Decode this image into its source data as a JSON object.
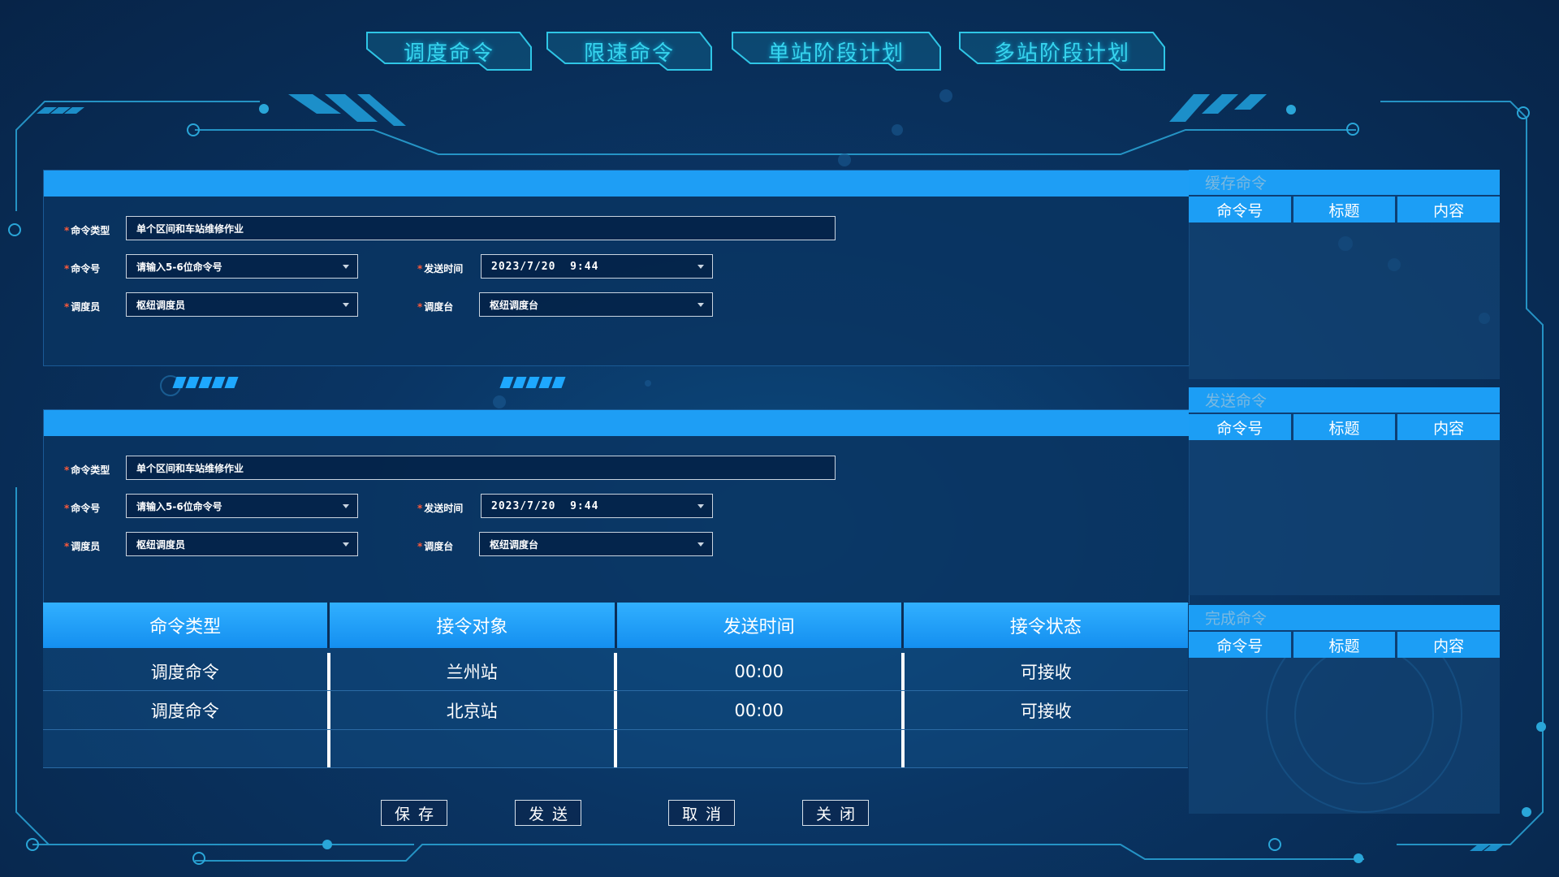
{
  "tabs": [
    {
      "label": "调度命令"
    },
    {
      "label": "限速命令"
    },
    {
      "label": "单站阶段计划"
    },
    {
      "label": "多站阶段计划"
    }
  ],
  "form1": {
    "type_label": "命令类型",
    "type_value": "单个区间和车站维修作业",
    "no_label": "命令号",
    "no_value": "请输入5-6位命令号",
    "time_label": "发送时间",
    "time_value": "2023/7/20  9:44",
    "dispatcher_label": "调度员",
    "dispatcher_value": "枢纽调度员",
    "desk_label": "调度台",
    "desk_value": "枢纽调度台"
  },
  "form2": {
    "type_label": "命令类型",
    "type_value": "单个区间和车站维修作业",
    "no_label": "命令号",
    "no_value": "请输入5-6位命令号",
    "time_label": "发送时间",
    "time_value": "2023/7/20  9:44",
    "dispatcher_label": "调度员",
    "dispatcher_value": "枢纽调度员",
    "desk_label": "调度台",
    "desk_value": "枢纽调度台"
  },
  "table": {
    "headers": [
      "命令类型",
      "接令对象",
      "发送时间",
      "接令状态"
    ],
    "rows": [
      [
        "调度命令",
        "兰州站",
        "00:00",
        "可接收"
      ],
      [
        "调度命令",
        "北京站",
        "00:00",
        "可接收"
      ],
      [
        "",
        "",
        "",
        ""
      ]
    ]
  },
  "side": {
    "cache": {
      "title": "缓存命令",
      "cols": [
        "命令号",
        "标题",
        "内容"
      ]
    },
    "sent": {
      "title": "发送命令",
      "cols": [
        "命令号",
        "标题",
        "内容"
      ]
    },
    "done": {
      "title": "完成命令",
      "cols": [
        "命令号",
        "标题",
        "内容"
      ]
    }
  },
  "buttons": {
    "save": "保存",
    "send": "发送",
    "cancel": "取消",
    "close": "关闭"
  },
  "colors": {
    "accent": "#1e9ef5",
    "tab_text": "#37d4ee",
    "required_star": "#ff5a3a"
  }
}
